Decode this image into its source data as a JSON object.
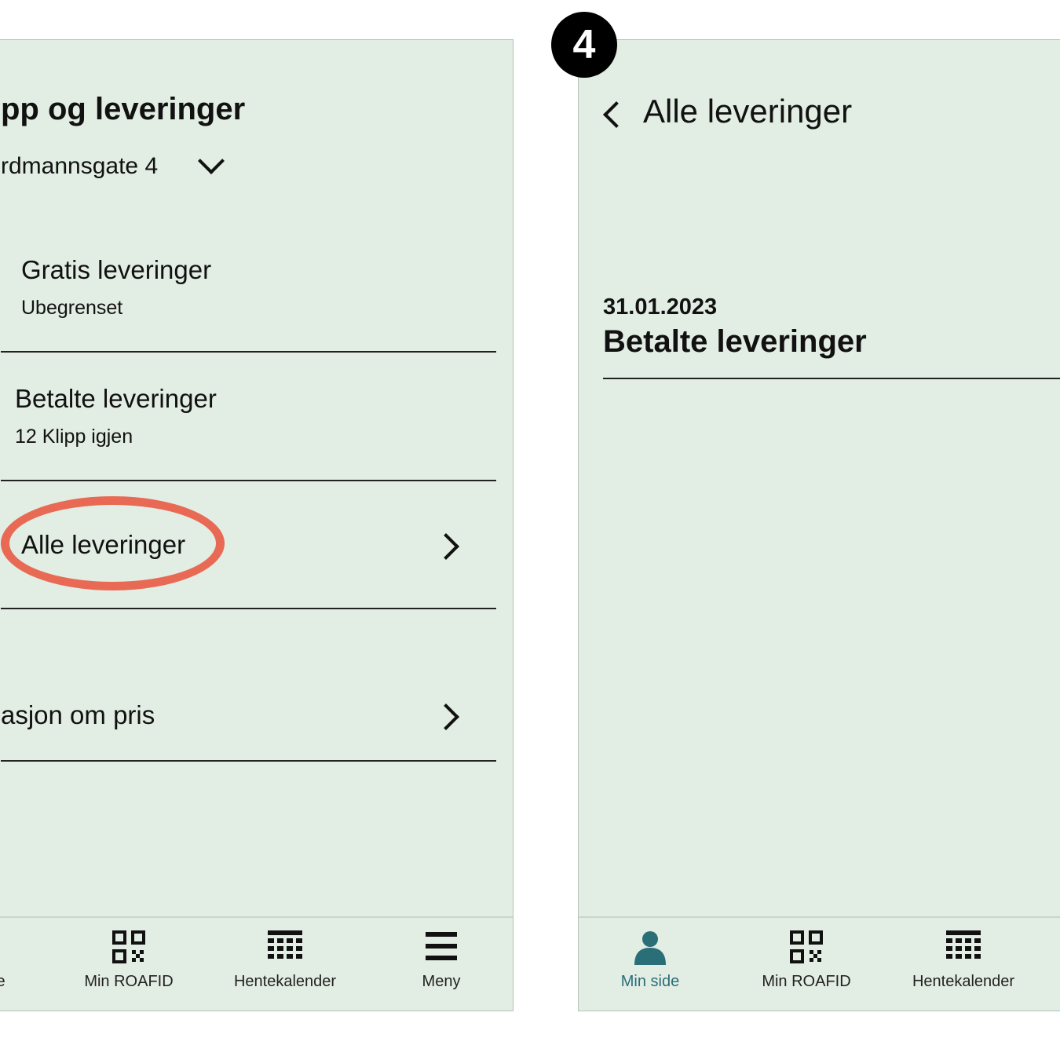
{
  "step_badge": "4",
  "left_screen": {
    "title": "pp og leveringer",
    "address": "rdmannsgate 4",
    "rows": [
      {
        "title": "Gratis leveringer",
        "subtitle": "Ubegrenset"
      },
      {
        "title": "Betalte leveringer",
        "subtitle": "12 Klipp igjen"
      },
      {
        "title": "Alle leveringer"
      },
      {
        "title": "asjon om pris"
      }
    ],
    "highlight_color": "#e86a54",
    "tabs": [
      {
        "label": "e",
        "icon": "person-icon"
      },
      {
        "label": "Min ROAFID",
        "icon": "qr-code-icon"
      },
      {
        "label": "Hentekalender",
        "icon": "calendar-grid-icon"
      },
      {
        "label": "Meny",
        "icon": "menu-icon"
      }
    ]
  },
  "right_screen": {
    "title": "Alle leveringer",
    "entries": [
      {
        "date": "31.01.2023",
        "title": "Betalte leveringer"
      }
    ],
    "tabs": [
      {
        "label": "Min side",
        "icon": "person-icon",
        "active": true
      },
      {
        "label": "Min ROAFID",
        "icon": "qr-code-icon"
      },
      {
        "label": "Hentekalender",
        "icon": "calendar-grid-icon"
      }
    ],
    "active_tab_color": "#2a6e78"
  },
  "colors": {
    "screen_bg": "#e2ede3",
    "text": "#111111"
  }
}
